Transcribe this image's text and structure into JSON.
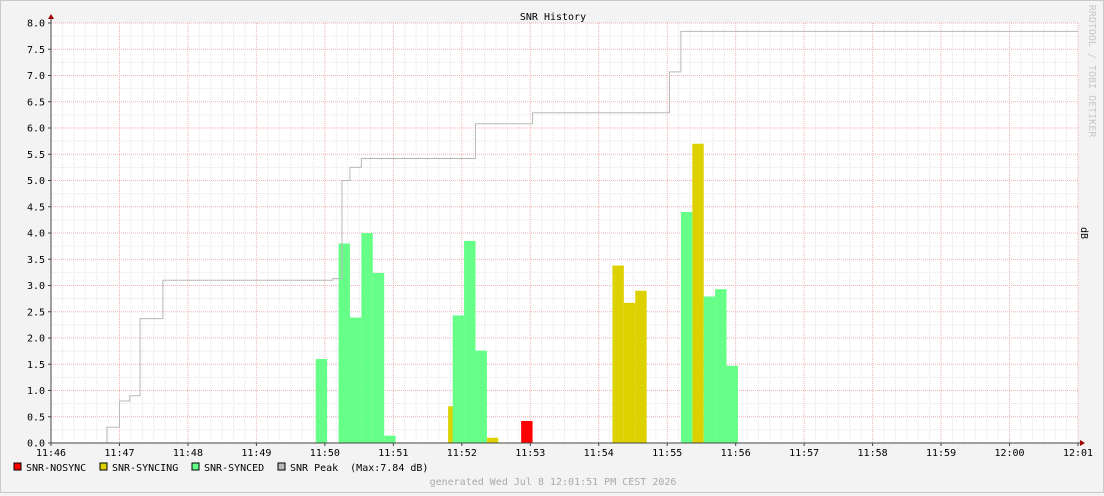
{
  "chart_data": {
    "type": "bar",
    "title": "SNR History",
    "ylabel": "dB",
    "watermark": "RRDTOOL / TOBI OETIKER",
    "footer": "generated Wed Jul  8 12:01:51 PM CEST 2026",
    "ylim": [
      0,
      8
    ],
    "yticks": [
      "0.0",
      "0.5",
      "1.0",
      "1.5",
      "2.0",
      "2.5",
      "3.0",
      "3.5",
      "4.0",
      "4.5",
      "5.0",
      "5.5",
      "6.0",
      "6.5",
      "7.0",
      "7.5",
      "8.0"
    ],
    "xticks": [
      "11:46",
      "11:47",
      "11:48",
      "11:49",
      "11:50",
      "11:51",
      "11:52",
      "11:53",
      "11:54",
      "11:55",
      "11:56",
      "11:57",
      "11:58",
      "11:59",
      "12:00",
      "12:01"
    ],
    "grid": true,
    "legend_position": "bottom-left",
    "bar_width_sec": 10,
    "series": [
      {
        "name": "SNR-NOSYNC",
        "color": "#ff0000",
        "bars": [
          [
            422,
            0.42
          ]
        ]
      },
      {
        "name": "SNR-SYNCING",
        "color": "#ddd200",
        "bars": [
          [
            358,
            0.7
          ],
          [
            392,
            0.1
          ],
          [
            502,
            3.38
          ],
          [
            512,
            2.67
          ],
          [
            522,
            2.9
          ],
          [
            572,
            5.7
          ]
        ]
      },
      {
        "name": "SNR-SYNCED",
        "color": "#66ff88",
        "bars": [
          [
            242,
            1.6
          ],
          [
            262,
            3.8
          ],
          [
            272,
            2.39
          ],
          [
            282,
            4.0
          ],
          [
            292,
            3.24
          ],
          [
            302,
            0.14
          ],
          [
            362,
            2.43
          ],
          [
            372,
            3.85
          ],
          [
            382,
            1.76
          ],
          [
            562,
            4.4
          ],
          [
            582,
            2.79
          ],
          [
            592,
            2.93
          ],
          [
            602,
            1.47
          ]
        ]
      },
      {
        "name": "SNR Peak",
        "color": "#b8b8b8",
        "suffix": "(Max:7.84 dB)",
        "steps": [
          [
            0,
            0
          ],
          [
            49,
            0.3
          ],
          [
            60,
            0.8
          ],
          [
            69,
            0.9
          ],
          [
            78,
            2.37
          ],
          [
            98,
            3.1
          ],
          [
            247,
            3.13
          ],
          [
            255,
            5.0
          ],
          [
            262,
            5.25
          ],
          [
            272,
            5.42
          ],
          [
            372,
            6.08
          ],
          [
            422,
            6.29
          ],
          [
            482,
            6.29
          ],
          [
            532,
            6.29
          ],
          [
            542,
            7.07
          ],
          [
            552,
            7.84
          ],
          [
            900,
            7.84
          ]
        ]
      }
    ]
  }
}
